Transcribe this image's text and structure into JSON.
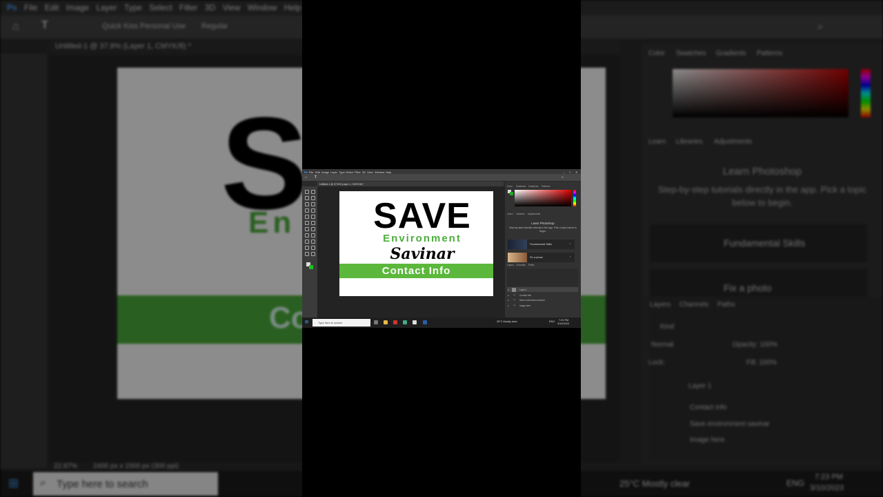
{
  "background": {
    "menu": [
      "File",
      "Edit",
      "Image",
      "Layer",
      "Type",
      "Select",
      "Filter",
      "3D",
      "View",
      "Window",
      "Help"
    ],
    "doc_tab": "Untitled-1 @ 37.8% (Layer 1, CMYK/8) *",
    "font_name": "Quick Kiss Personal Use",
    "font_style": "Regular",
    "big_letter": "S",
    "env_partial": "En",
    "contact_partial": "Co",
    "panel_tabs": [
      "Color",
      "Swatches",
      "Gradients",
      "Patterns"
    ],
    "learn_tabs": [
      "Learn",
      "Libraries",
      "Adjustments"
    ],
    "learn_title": "Learn Photoshop",
    "learn_sub": "Step-by-step tutorials directly in the app. Pick a topic below to begin.",
    "card1": "Fundamental Skills",
    "card2": "Fix a photo",
    "layers_tabs": [
      "Layers",
      "Channels",
      "Paths"
    ],
    "kind": "Kind",
    "blend": "Normal",
    "opacity": "Opacity: 100%",
    "fill": "Fill: 100%",
    "lock": "Lock:",
    "layer_items": [
      "Layer 1",
      "Contact info",
      "Save environment savinar",
      "Image here"
    ],
    "status_zoom": "22.97%",
    "status_size": "2400 px x 1500 px (300 ppi)",
    "taskbar_search": "Type here to search",
    "weather": "25°C  Mostly clear",
    "lang": "ENG",
    "time": "7:23 PM",
    "date": "3/10/2023"
  },
  "mini": {
    "menu": [
      "Ps",
      "File",
      "Edit",
      "Image",
      "Layer",
      "Type",
      "Select",
      "Filter",
      "3D",
      "View",
      "Window",
      "Help"
    ],
    "doc_tab": "Untitled-1 @ 37.8% (Layer 1, CMYK/8) *",
    "canvas": {
      "title": "SAVE",
      "subtitle": "Environment",
      "script": "Savinar",
      "bar_label": "Contact Info"
    },
    "learn_title": "Learn Photoshop",
    "learn_sub": "Step-by-step tutorials directly in the app. Pick a topic below to begin.",
    "card1": "Fundamental Skills",
    "card2": "Fix a photo",
    "layers": [
      "Layer 1",
      "Contact info",
      "Save environment savinar",
      "Image here"
    ],
    "taskbar_search": "Type here to search",
    "weather": "25°C  Mostly clear",
    "lang": "ENG",
    "time": "7:23 PM",
    "date": "3/10/2023"
  },
  "colors": {
    "accent_green": "#4cae3b",
    "bar_green": "#5cb83c",
    "ps_dark": "#2a2a2a"
  }
}
